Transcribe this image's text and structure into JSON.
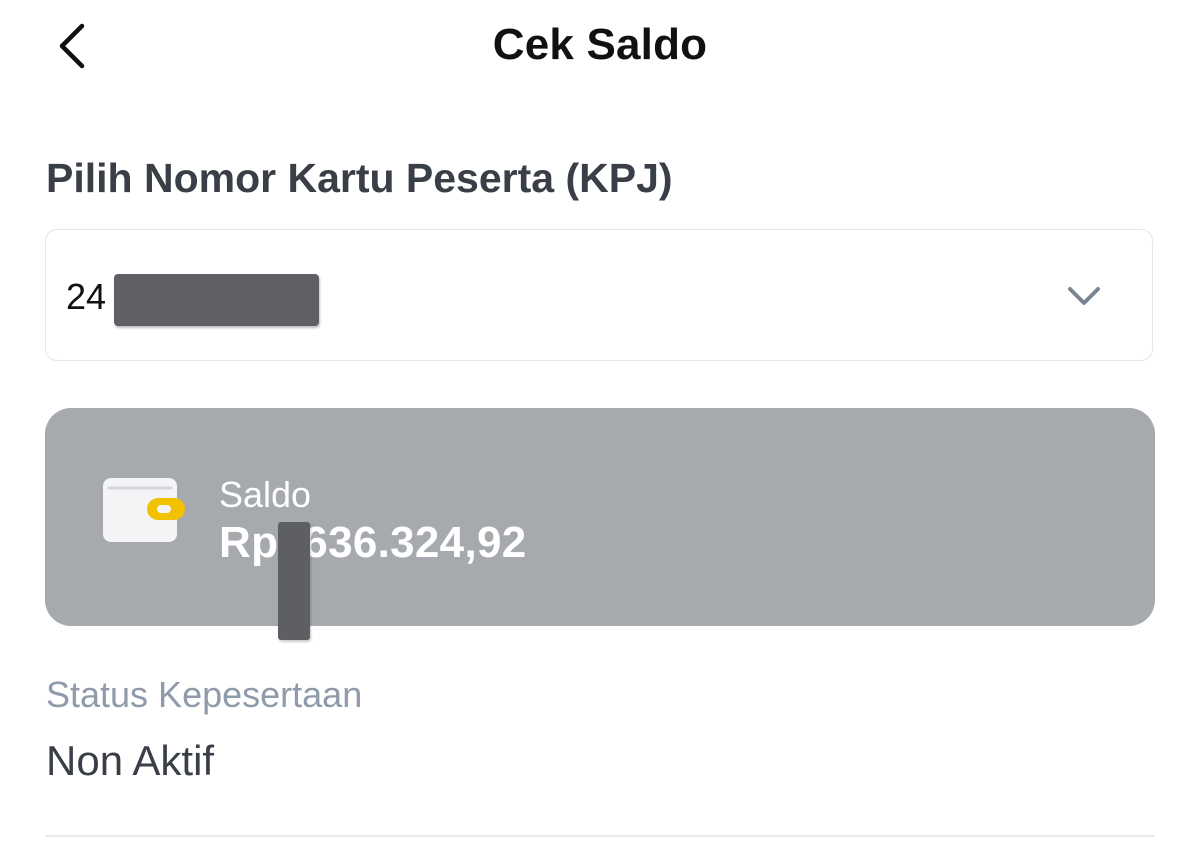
{
  "header": {
    "title": "Cek Saldo"
  },
  "kpj": {
    "label": "Pilih Nomor Kartu Peserta (KPJ)",
    "selected_value": "24"
  },
  "balance": {
    "label": "Saldo",
    "value": "Rp  .636.324,92"
  },
  "status": {
    "label": "Status Kepesertaan",
    "value": "Non Aktif"
  },
  "icons": {
    "back": "chevron-left-icon",
    "dropdown": "chevron-down-icon",
    "wallet": "wallet-icon"
  },
  "colors": {
    "card_background": "#a6a9ad",
    "wallet_clasp": "#f2c200",
    "status_label": "#8f9bab"
  }
}
